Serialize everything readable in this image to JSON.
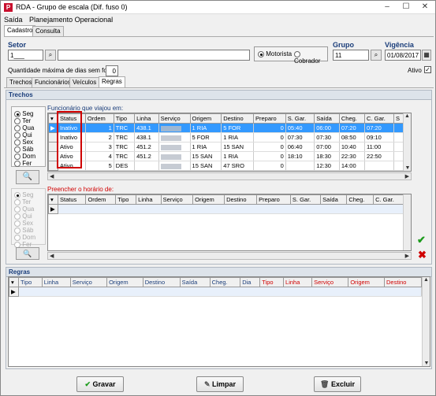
{
  "window": {
    "title": "RDA - Grupo de escala (Dif. fuso 0)",
    "app_icon": "P"
  },
  "menu": [
    "Saída",
    "Planejamento Operacional"
  ],
  "top_tabs": [
    "Cadastro",
    "Consulta"
  ],
  "setor": {
    "label": "Setor",
    "code": "1___",
    "name": ""
  },
  "tipo": {
    "motorista": "Motorista",
    "cobrador": "Cobrador",
    "selected": "motorista"
  },
  "grupo": {
    "label": "Grupo",
    "value": "11"
  },
  "vigencia": {
    "label": "Vigência",
    "value": "01/08/2017"
  },
  "folga": {
    "label": "Quantidade máxima de dias sem folga",
    "value": "0"
  },
  "ativo": {
    "label": "Ativo",
    "checked": true
  },
  "sub_tabs": [
    "Trechos",
    "Funcionários",
    "Veículos",
    "Regras"
  ],
  "trechos": {
    "header": "Trechos",
    "days": [
      "Seg",
      "Ter",
      "Qua",
      "Qui",
      "Sex",
      "Sáb",
      "Dom",
      "Fer"
    ],
    "selected_day": "Seg",
    "grid1_caption": "Funcionário que viajou em:",
    "grid2_caption": "Preencher o horário de:",
    "columns1": [
      "Status",
      "Ordem",
      "Tipo",
      "Linha",
      "Serviço",
      "Origem",
      "Destino",
      "Preparo",
      "S. Gar.",
      "Saída",
      "Cheg.",
      "C. Gar.",
      "S"
    ],
    "rows1": [
      {
        "status": "Inativo",
        "ordem": "1",
        "tipo": "TRC",
        "linha": "438.1",
        "servico": "",
        "origem": "1 RIA",
        "destino": "5 FOR",
        "preparo": "0",
        "sgar": "05:40",
        "saida": "06:00",
        "cheg": "07:20",
        "cgar": "07:20"
      },
      {
        "status": "Inativo",
        "ordem": "2",
        "tipo": "TRC",
        "linha": "438.1",
        "servico": "",
        "origem": "5 FOR",
        "destino": "1 RIA",
        "preparo": "0",
        "sgar": "07:30",
        "saida": "07:30",
        "cheg": "08:50",
        "cgar": "09:10"
      },
      {
        "status": "Ativo",
        "ordem": "3",
        "tipo": "TRC",
        "linha": "451.2",
        "servico": "",
        "origem": "1 RIA",
        "destino": "15 SAN",
        "preparo": "0",
        "sgar": "06:40",
        "saida": "07:00",
        "cheg": "10:40",
        "cgar": "11:00"
      },
      {
        "status": "Ativo",
        "ordem": "4",
        "tipo": "TRC",
        "linha": "451.2",
        "servico": "",
        "origem": "15 SAN",
        "destino": "1 RIA",
        "preparo": "0",
        "sgar": "18:10",
        "saida": "18:30",
        "cheg": "22:30",
        "cgar": "22:50"
      },
      {
        "status": "Ativo",
        "ordem": "5",
        "tipo": "DES",
        "linha": "",
        "servico": "",
        "origem": "15 SAN",
        "destino": "47 SRO",
        "preparo": "0",
        "sgar": "",
        "saida": "12:30",
        "cheg": "14:00",
        "cgar": ""
      }
    ],
    "columns2": [
      "Status",
      "Ordem",
      "Tipo",
      "Linha",
      "Serviço",
      "Origem",
      "Destino",
      "Preparo",
      "S. Gar.",
      "Saída",
      "Cheg.",
      "C. Gar."
    ]
  },
  "regras": {
    "header": "Regras",
    "columns": [
      "Tipo",
      "Linha",
      "Serviço",
      "Origem",
      "Destino",
      "Saída",
      "Cheg.",
      "Dia",
      "Tipo",
      "Linha",
      "Serviço",
      "Origem",
      "Destino"
    ]
  },
  "buttons": {
    "gravar": "Gravar",
    "limpar": "Limpar",
    "excluir": "Excluir"
  },
  "colors": {
    "accent": "#3399ff",
    "header_blue": "#1a3d7a",
    "red": "#d00000",
    "highlight": "#d00000"
  }
}
